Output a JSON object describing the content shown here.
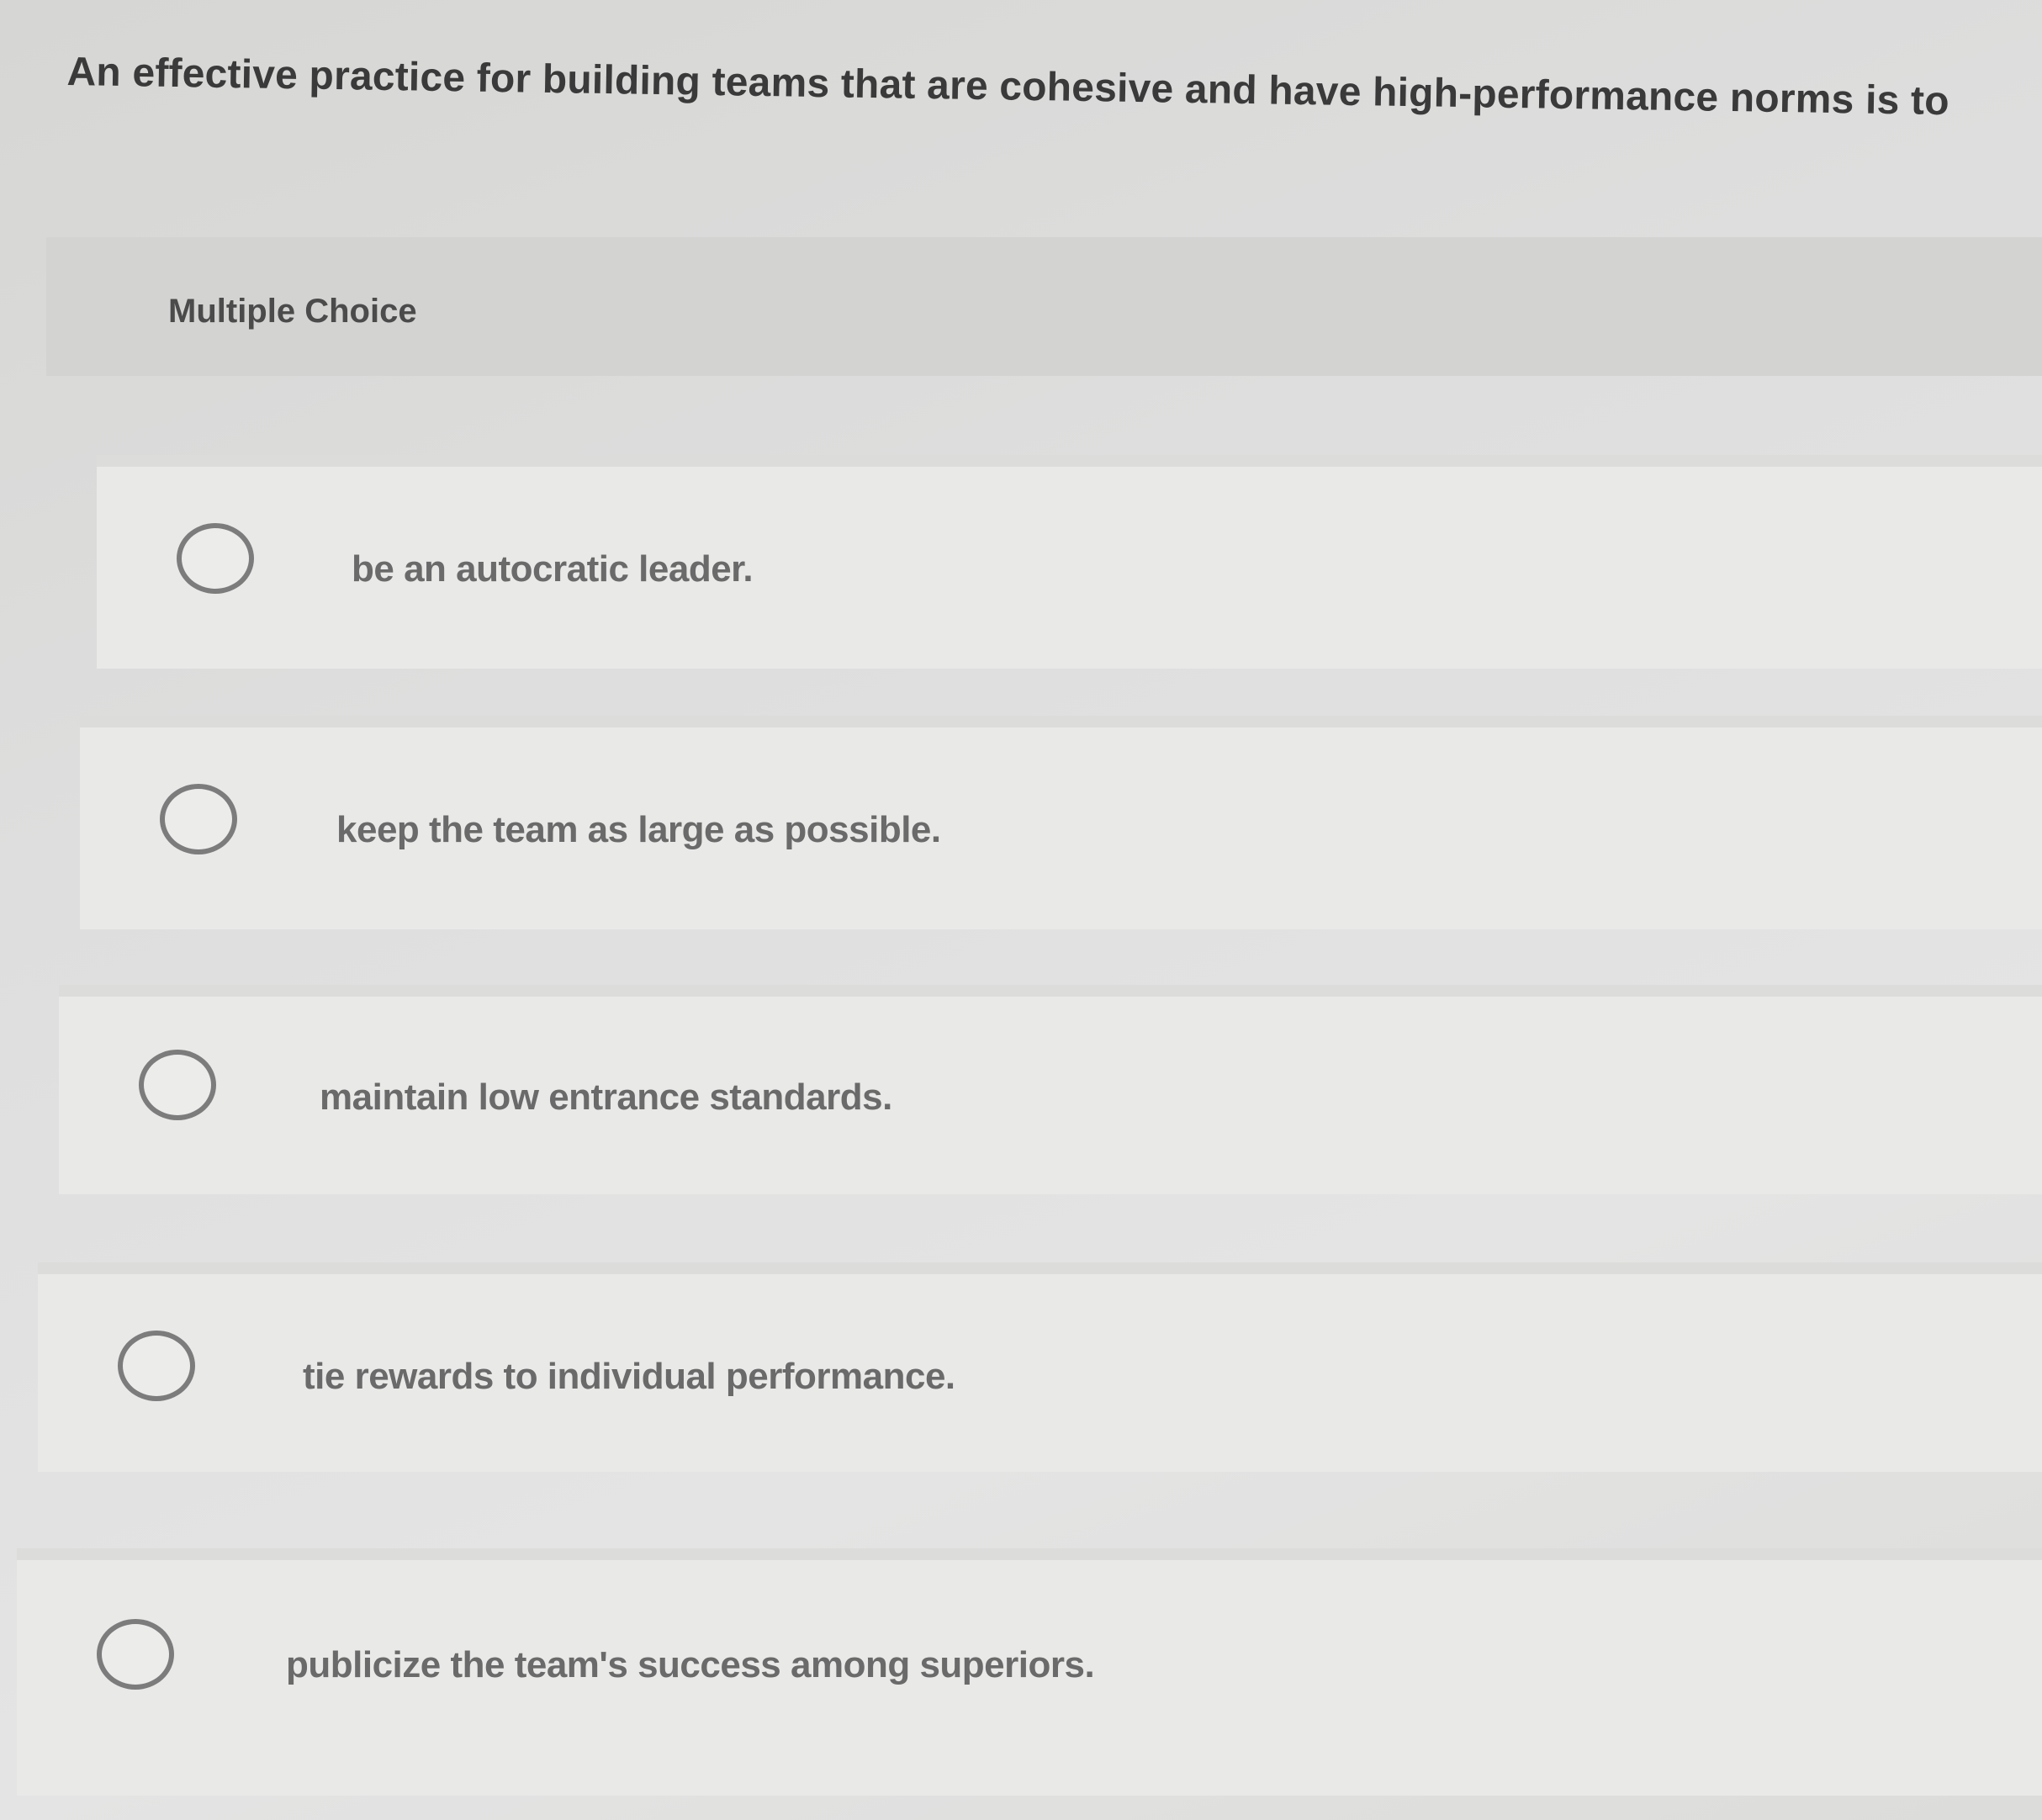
{
  "question": {
    "text": "An effective practice for building teams that are cohesive and have high-performance norms is to"
  },
  "question_type": "Multiple Choice",
  "choices": [
    {
      "label": "be an autocratic leader."
    },
    {
      "label": "keep the team as large as possible."
    },
    {
      "label": "maintain low entrance standards."
    },
    {
      "label": "tie rewards to individual performance."
    },
    {
      "label": "publicize the team's success among superiors."
    }
  ]
}
